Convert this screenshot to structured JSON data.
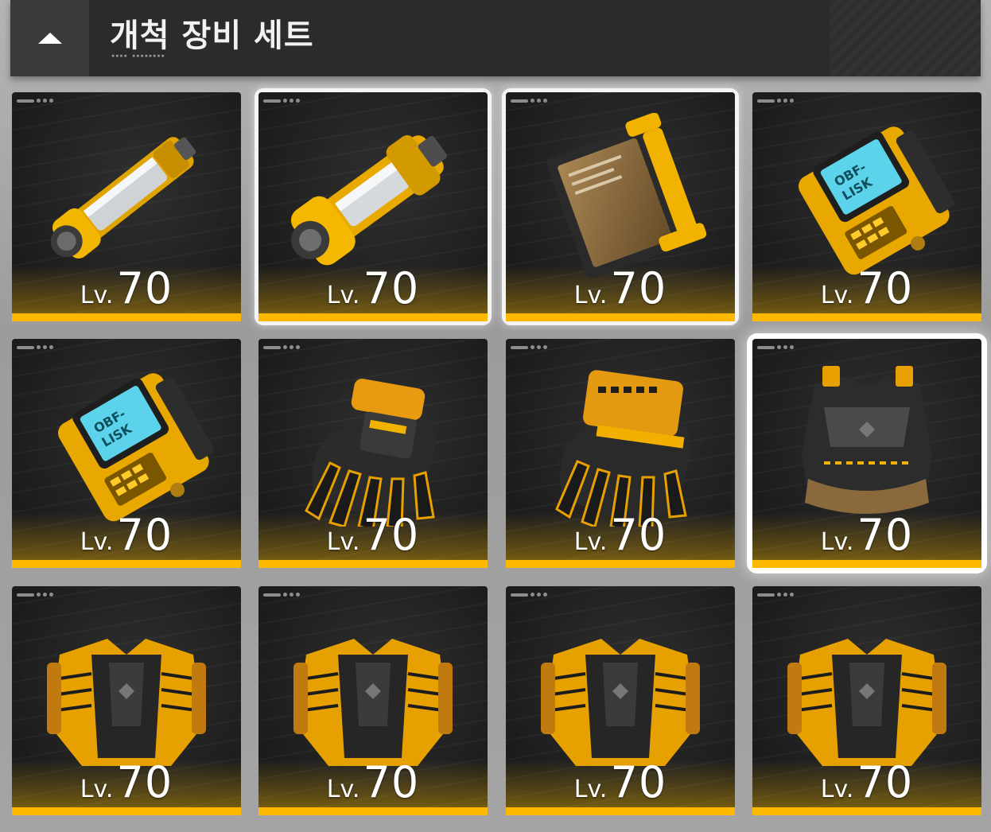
{
  "header": {
    "title": "개척 장비 세트",
    "toggle_icon": "caret-up-icon"
  },
  "colors": {
    "accent": "#ffb800",
    "card_bg": "#1c1c1c",
    "header_bg": "#2b2b2b"
  },
  "items": [
    {
      "icon": "tube-device-icon",
      "level_prefix": "Lv.",
      "level": "70",
      "state": "normal"
    },
    {
      "icon": "reinforced-tube-device-icon",
      "level_prefix": "Lv.",
      "level": "70",
      "state": "selected"
    },
    {
      "icon": "tablet-frame-icon",
      "level_prefix": "Lv.",
      "level": "70",
      "state": "selected"
    },
    {
      "icon": "screen-device-icon",
      "level_prefix": "Lv.",
      "level": "70",
      "state": "normal"
    },
    {
      "icon": "screen-device-icon",
      "level_prefix": "Lv.",
      "level": "70",
      "state": "normal"
    },
    {
      "icon": "glove-icon",
      "level_prefix": "Lv.",
      "level": "70",
      "state": "normal"
    },
    {
      "icon": "armored-glove-icon",
      "level_prefix": "Lv.",
      "level": "70",
      "state": "normal"
    },
    {
      "icon": "vest-icon",
      "level_prefix": "Lv.",
      "level": "70",
      "state": "focus"
    },
    {
      "icon": "armor-pack-icon",
      "level_prefix": "Lv.",
      "level": "70",
      "state": "normal"
    },
    {
      "icon": "armor-pack-icon",
      "level_prefix": "Lv.",
      "level": "70",
      "state": "normal"
    },
    {
      "icon": "armor-pack-icon",
      "level_prefix": "Lv.",
      "level": "70",
      "state": "normal"
    },
    {
      "icon": "armor-pack-icon",
      "level_prefix": "Lv.",
      "level": "70",
      "state": "normal"
    }
  ]
}
